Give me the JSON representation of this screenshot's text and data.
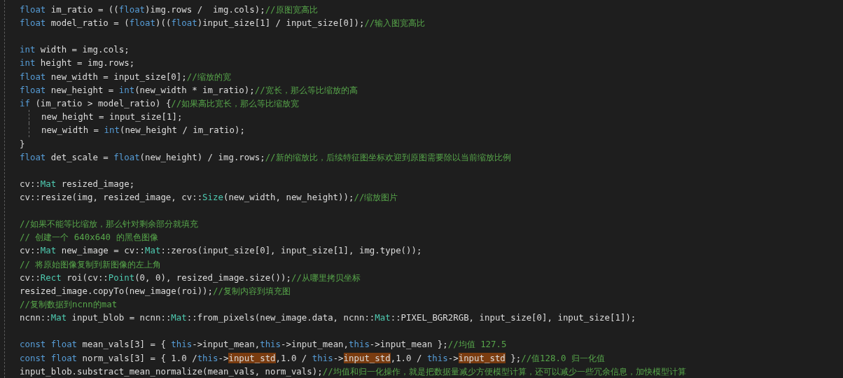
{
  "editor": {
    "lines": [
      {
        "kind": "code",
        "indented": false,
        "tokens": [
          {
            "kind": "keyword",
            "text": "float"
          },
          {
            "kind": "plain",
            "text": " im_ratio = (("
          },
          {
            "kind": "keyword",
            "text": "float"
          },
          {
            "kind": "plain",
            "text": ")img.rows /  img.cols);"
          },
          {
            "kind": "comment",
            "text": "//原图宽高比"
          }
        ]
      },
      {
        "kind": "code",
        "indented": false,
        "tokens": [
          {
            "kind": "keyword",
            "text": "float"
          },
          {
            "kind": "plain",
            "text": " model_ratio = ("
          },
          {
            "kind": "keyword",
            "text": "float"
          },
          {
            "kind": "plain",
            "text": ")(("
          },
          {
            "kind": "keyword",
            "text": "float"
          },
          {
            "kind": "plain",
            "text": ")input_size[1] / input_size[0]);"
          },
          {
            "kind": "comment",
            "text": "//输入图宽高比"
          }
        ]
      },
      {
        "kind": "blank"
      },
      {
        "kind": "code",
        "indented": false,
        "tokens": [
          {
            "kind": "keyword",
            "text": "int"
          },
          {
            "kind": "plain",
            "text": " width = img.cols;"
          }
        ]
      },
      {
        "kind": "code",
        "indented": false,
        "tokens": [
          {
            "kind": "keyword",
            "text": "int"
          },
          {
            "kind": "plain",
            "text": " height = img.rows;"
          }
        ]
      },
      {
        "kind": "code",
        "indented": false,
        "tokens": [
          {
            "kind": "keyword",
            "text": "float"
          },
          {
            "kind": "plain",
            "text": " new_width = input_size[0];"
          },
          {
            "kind": "comment",
            "text": "//缩放的宽"
          }
        ]
      },
      {
        "kind": "code",
        "indented": false,
        "tokens": [
          {
            "kind": "keyword",
            "text": "float"
          },
          {
            "kind": "plain",
            "text": " new_height = "
          },
          {
            "kind": "keyword",
            "text": "int"
          },
          {
            "kind": "plain",
            "text": "(new_width * im_ratio);"
          },
          {
            "kind": "comment",
            "text": "//宽长，那么等比缩放的高"
          }
        ]
      },
      {
        "kind": "code",
        "indented": false,
        "tokens": [
          {
            "kind": "keyword",
            "text": "if"
          },
          {
            "kind": "plain",
            "text": " (im_ratio > model_ratio) {"
          },
          {
            "kind": "comment",
            "text": "//如果高比宽长，那么等比缩放宽"
          }
        ]
      },
      {
        "kind": "code",
        "indented": true,
        "tokens": [
          {
            "kind": "plain",
            "text": "new_height = input_size[1];"
          }
        ]
      },
      {
        "kind": "code",
        "indented": true,
        "tokens": [
          {
            "kind": "plain",
            "text": "new_width = "
          },
          {
            "kind": "keyword",
            "text": "int"
          },
          {
            "kind": "plain",
            "text": "(new_height / im_ratio);"
          }
        ]
      },
      {
        "kind": "code",
        "indented": false,
        "tokens": [
          {
            "kind": "plain",
            "text": "}"
          }
        ]
      },
      {
        "kind": "code",
        "indented": false,
        "tokens": [
          {
            "kind": "keyword",
            "text": "float"
          },
          {
            "kind": "plain",
            "text": " det_scale = "
          },
          {
            "kind": "keyword",
            "text": "float"
          },
          {
            "kind": "plain",
            "text": "(new_height) / img.rows;"
          },
          {
            "kind": "comment",
            "text": "//新的缩放比，后续特征图坐标欢迎到原图需要除以当前缩放比例"
          }
        ]
      },
      {
        "kind": "blank"
      },
      {
        "kind": "code",
        "indented": false,
        "tokens": [
          {
            "kind": "plain",
            "text": "cv::"
          },
          {
            "kind": "type",
            "text": "Mat"
          },
          {
            "kind": "plain",
            "text": " resized_image;"
          }
        ]
      },
      {
        "kind": "code",
        "indented": false,
        "tokens": [
          {
            "kind": "plain",
            "text": "cv::resize(img, resized_image, cv::"
          },
          {
            "kind": "type",
            "text": "Size"
          },
          {
            "kind": "plain",
            "text": "(new_width, new_height));"
          },
          {
            "kind": "comment",
            "text": "//缩放图片"
          }
        ]
      },
      {
        "kind": "blank"
      },
      {
        "kind": "code",
        "indented": false,
        "tokens": [
          {
            "kind": "comment",
            "text": "//如果不能等比缩放，那么针对剩余部分就填充"
          }
        ]
      },
      {
        "kind": "code",
        "indented": false,
        "tokens": [
          {
            "kind": "comment",
            "text": "// 创建一个 640x640 的黑色图像"
          }
        ]
      },
      {
        "kind": "code",
        "indented": false,
        "tokens": [
          {
            "kind": "plain",
            "text": "cv::"
          },
          {
            "kind": "type",
            "text": "Mat"
          },
          {
            "kind": "plain",
            "text": " new_image = cv::"
          },
          {
            "kind": "type",
            "text": "Mat"
          },
          {
            "kind": "plain",
            "text": "::zeros(input_size[0], input_size[1], img.type());"
          }
        ]
      },
      {
        "kind": "code",
        "indented": false,
        "tokens": [
          {
            "kind": "comment",
            "text": "// 将原始图像复制到新图像的左上角"
          }
        ]
      },
      {
        "kind": "code",
        "indented": false,
        "tokens": [
          {
            "kind": "plain",
            "text": "cv::"
          },
          {
            "kind": "type",
            "text": "Rect"
          },
          {
            "kind": "plain",
            "text": " roi(cv::"
          },
          {
            "kind": "type",
            "text": "Point"
          },
          {
            "kind": "plain",
            "text": "(0, 0), resized_image.size());"
          },
          {
            "kind": "comment",
            "text": "//从哪里拷贝坐标"
          }
        ]
      },
      {
        "kind": "code",
        "indented": false,
        "tokens": [
          {
            "kind": "plain",
            "text": "resized_image.copyTo(new_image(roi));"
          },
          {
            "kind": "comment",
            "text": "//复制内容到填充图"
          }
        ]
      },
      {
        "kind": "code",
        "indented": false,
        "tokens": [
          {
            "kind": "comment",
            "text": "//复制数据到ncnn的mat"
          }
        ]
      },
      {
        "kind": "code",
        "indented": false,
        "tokens": [
          {
            "kind": "plain",
            "text": "ncnn::"
          },
          {
            "kind": "type",
            "text": "Mat"
          },
          {
            "kind": "plain",
            "text": " input_blob = ncnn::"
          },
          {
            "kind": "type",
            "text": "Mat"
          },
          {
            "kind": "plain",
            "text": "::from_pixels(new_image.data, ncnn::"
          },
          {
            "kind": "type",
            "text": "Mat"
          },
          {
            "kind": "plain",
            "text": "::PIXEL_BGR2RGB, input_size[0], input_size[1]);"
          }
        ]
      },
      {
        "kind": "blank"
      },
      {
        "kind": "code",
        "indented": false,
        "tokens": [
          {
            "kind": "keyword",
            "text": "const"
          },
          {
            "kind": "keyword",
            "text": " float"
          },
          {
            "kind": "plain",
            "text": " mean_vals[3] = { "
          },
          {
            "kind": "keyword",
            "text": "this"
          },
          {
            "kind": "plain",
            "text": "->input_mean,"
          },
          {
            "kind": "keyword",
            "text": "this"
          },
          {
            "kind": "plain",
            "text": "->input_mean,"
          },
          {
            "kind": "keyword",
            "text": "this"
          },
          {
            "kind": "plain",
            "text": "->input_mean };"
          },
          {
            "kind": "comment",
            "text": "//均值 127.5"
          }
        ]
      },
      {
        "kind": "code",
        "indented": false,
        "tokens": [
          {
            "kind": "keyword",
            "text": "const"
          },
          {
            "kind": "keyword",
            "text": " float"
          },
          {
            "kind": "plain",
            "text": " norm_vals[3] = { 1.0 /"
          },
          {
            "kind": "keyword",
            "text": "this"
          },
          {
            "kind": "plain",
            "text": "->"
          },
          {
            "kind": "highlight",
            "text": "input_std"
          },
          {
            "kind": "plain",
            "text": ",1.0 / "
          },
          {
            "kind": "keyword",
            "text": "this"
          },
          {
            "kind": "plain",
            "text": "->"
          },
          {
            "kind": "highlight",
            "text": "input_std"
          },
          {
            "kind": "plain",
            "text": ",1.0 / "
          },
          {
            "kind": "keyword",
            "text": "this"
          },
          {
            "kind": "plain",
            "text": "->"
          },
          {
            "kind": "highlight",
            "text": "input_std"
          },
          {
            "kind": "plain",
            "text": " };"
          },
          {
            "kind": "comment",
            "text": "//值128.0 归一化值"
          }
        ]
      },
      {
        "kind": "code",
        "indented": false,
        "tokens": [
          {
            "kind": "plain",
            "text": "input_blob.substract_mean_normalize(mean_vals, norm_vals);"
          },
          {
            "kind": "comment",
            "text": "//均值和归一化操作，就是把数据量减少方便模型计算，还可以减少一些冗余信息，加快模型计算"
          }
        ]
      }
    ]
  }
}
